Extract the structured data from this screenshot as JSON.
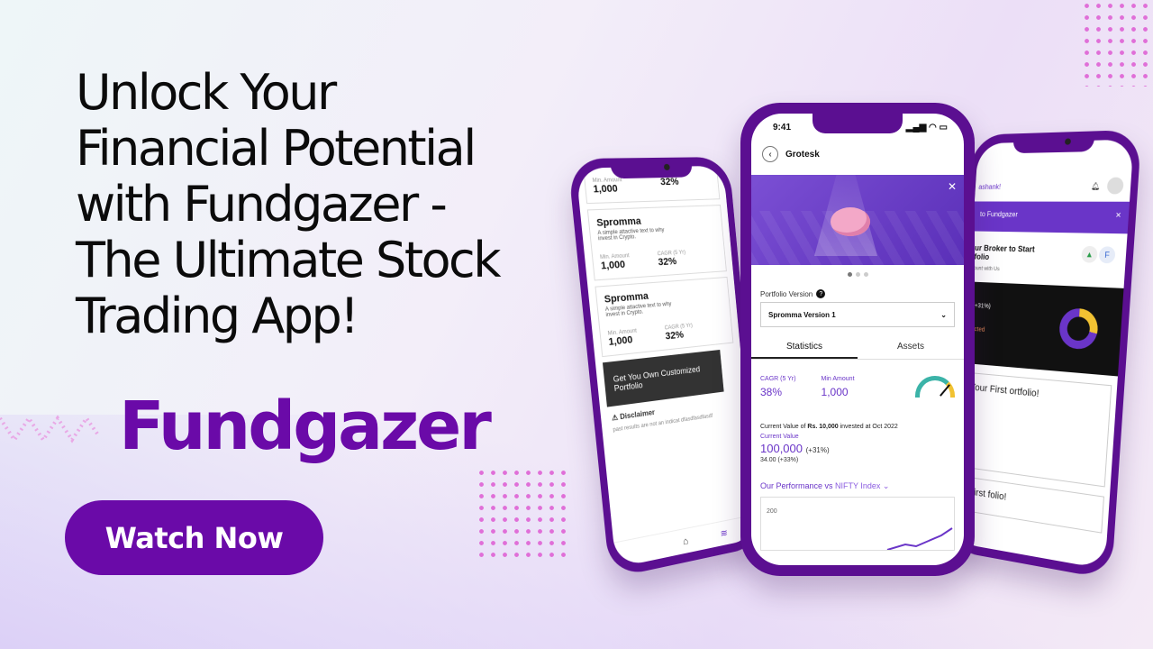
{
  "headline": [
    "Unlock Your",
    "Financial Potential",
    "with Fundgazer -",
    "The Ultimate Stock",
    "Trading App!"
  ],
  "brand_name": "Fundgazer",
  "cta_label": "Watch Now",
  "colors": {
    "brand": "#6a0aa8",
    "accent_dots": "#e06fd8"
  },
  "left_phone": {
    "top_card": {
      "min_label": "Min. Amount",
      "min_value": "1,000",
      "cagr_value": "32%"
    },
    "cards": [
      {
        "name": "Spromma",
        "desc": "A simple attactive text to why invest in Crypto.",
        "min_label": "Min. Amount",
        "min_value": "1,000",
        "cagr_label": "CAGR (5 Yr)",
        "cagr_value": "32%"
      },
      {
        "name": "Spromma",
        "desc": "A simple attactive text to why invest in Crypto.",
        "min_label": "Min. Amount",
        "min_value": "1,000",
        "cagr_label": "CAGR (5 Yr)",
        "cagr_value": "32%"
      }
    ],
    "cta": "Get You Own Customized Portfolio",
    "disclaimer_title": "Disclaimer",
    "disclaimer_text": "past results are not an indicat dfasdfasdfasdf"
  },
  "center_phone": {
    "time": "9:41",
    "status_icons": "▂▄▆ ◠ ▭",
    "back_icon": "chevron-left-icon",
    "title": "Grotesk",
    "portfolio_version_label": "Portfolio Version",
    "help_badge": "?",
    "portfolio_version_value": "Spromma Version 1",
    "tabs": [
      "Statistics",
      "Assets"
    ],
    "stats": {
      "cagr_label": "CAGR (5 Yr)",
      "cagr_value": "38%",
      "min_label": "Min Amount",
      "min_value": "1,000"
    },
    "current_value_prefix": "Current Value of",
    "current_value_amount": "Rs. 10,000",
    "current_value_suffix": "invested at Oct 2022",
    "current_value_label": "Current Value",
    "current_value": "100,000",
    "current_value_change": "(+31%)",
    "current_value_sub": "34.00 (+33%)",
    "performance_label": "Our Performance vs",
    "performance_index": "NIFTY Index",
    "chart_tick": "200"
  },
  "right_phone": {
    "greeting": "ashank!",
    "banner": "to Fundgazer",
    "connect_title": "ur Broker to Start folio",
    "connect_sub": "ount with Us",
    "panel_change": "(+31%)",
    "panel_status": "ected",
    "card1": "Your First ortfolio!",
    "card2": "r First folio!"
  }
}
